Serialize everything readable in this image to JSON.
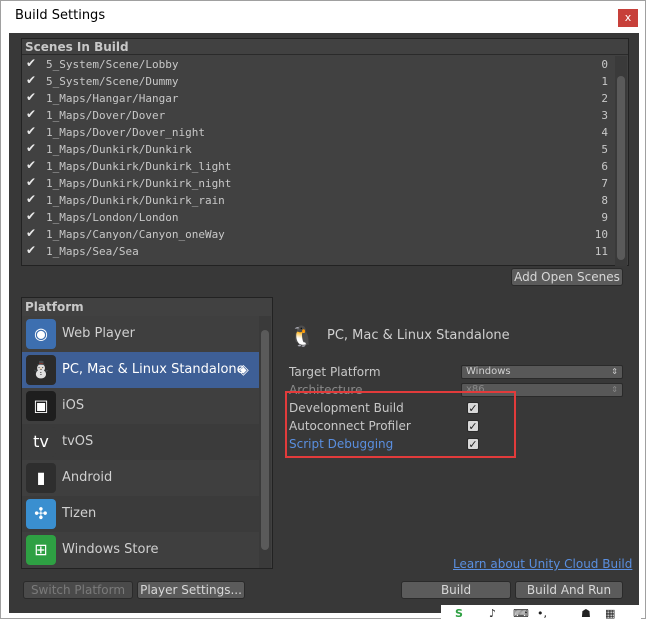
{
  "window": {
    "title": "Build Settings",
    "close_label": "x"
  },
  "scenes": {
    "header": "Scenes In Build",
    "items": [
      {
        "name": "5_System/Scene/Lobby",
        "index": "0"
      },
      {
        "name": "5_System/Scene/Dummy",
        "index": "1"
      },
      {
        "name": "1_Maps/Hangar/Hangar",
        "index": "2"
      },
      {
        "name": "1_Maps/Dover/Dover",
        "index": "3"
      },
      {
        "name": "1_Maps/Dover/Dover_night",
        "index": "4"
      },
      {
        "name": "1_Maps/Dunkirk/Dunkirk",
        "index": "5"
      },
      {
        "name": "1_Maps/Dunkirk/Dunkirk_light",
        "index": "6"
      },
      {
        "name": "1_Maps/Dunkirk/Dunkirk_night",
        "index": "7"
      },
      {
        "name": "1_Maps/Dunkirk/Dunkirk_rain",
        "index": "8"
      },
      {
        "name": "1_Maps/London/London",
        "index": "9"
      },
      {
        "name": "1_Maps/Canyon/Canyon_oneWay",
        "index": "10"
      },
      {
        "name": "1_Maps/Sea/Sea",
        "index": "11"
      }
    ],
    "add_open_scenes_label": "Add Open Scenes"
  },
  "platform": {
    "header": "Platform",
    "items": [
      {
        "label": "Web Player",
        "icon": "globe-icon",
        "color": "#3d6fb0",
        "glyph": "◉"
      },
      {
        "label": "PC, Mac & Linux Standalone",
        "icon": "penguin-icon",
        "color": "#2b2b2b",
        "glyph": "⛄",
        "selected": true
      },
      {
        "label": "iOS",
        "icon": "ipad-icon",
        "color": "#1e1e1e",
        "glyph": "▣"
      },
      {
        "label": "tvOS",
        "icon": "appletv-icon",
        "color": "#3b3b3b",
        "glyph": "tv"
      },
      {
        "label": "Android",
        "icon": "android-phone-icon",
        "color": "#2e2e2e",
        "glyph": "▮"
      },
      {
        "label": "Tizen",
        "icon": "tizen-icon",
        "color": "#3a8fd0",
        "glyph": "✣"
      },
      {
        "label": "Windows Store",
        "icon": "windows-store-icon",
        "color": "#2ea043",
        "glyph": "⊞"
      }
    ]
  },
  "settings": {
    "title": "PC, Mac & Linux Standalone",
    "target_platform_label": "Target Platform",
    "target_platform_value": "Windows",
    "architecture_label": "Architecture",
    "architecture_value": "x86",
    "development_build_label": "Development Build",
    "autoconnect_profiler_label": "Autoconnect Profiler",
    "script_debugging_label": "Script Debugging",
    "cloud_build_link": "Learn about Unity Cloud Build"
  },
  "buttons": {
    "switch_platform": "Switch Platform",
    "player_settings": "Player Settings...",
    "build": "Build",
    "build_and_run": "Build And Run"
  },
  "colors": {
    "accent_selected": "#3e5f96",
    "link": "#5a8fe0",
    "highlight_box": "#e23b3b"
  }
}
